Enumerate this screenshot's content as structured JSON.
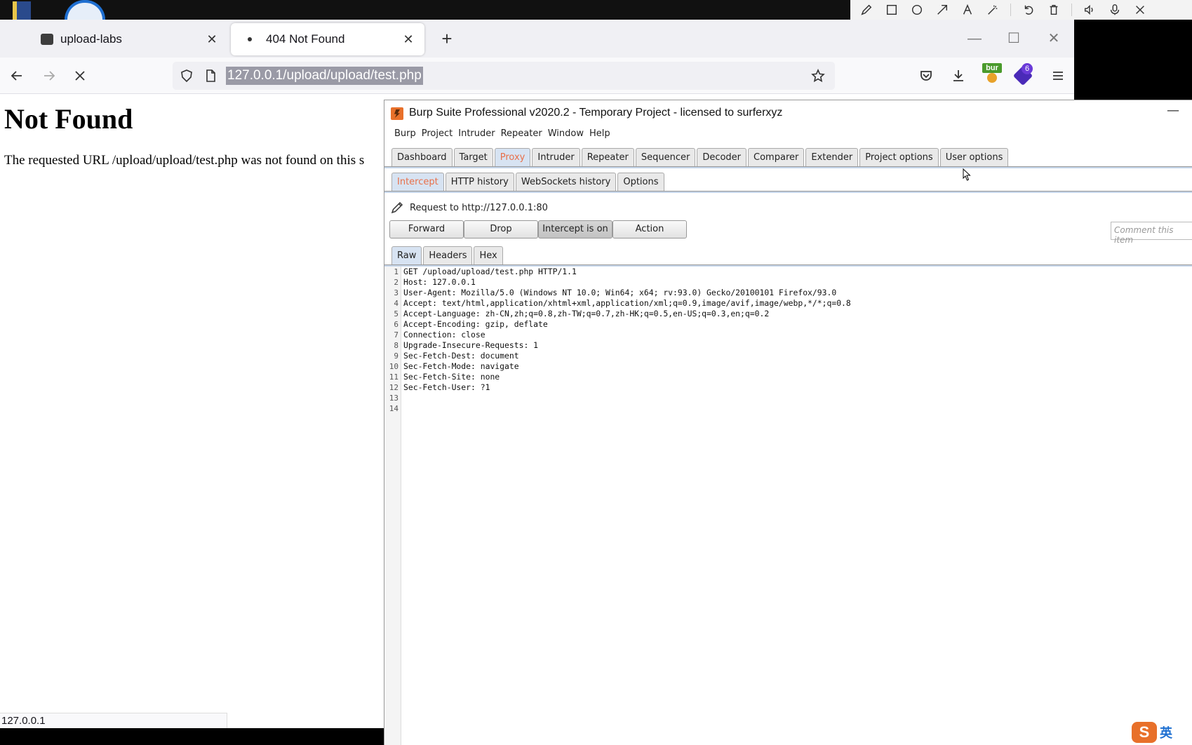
{
  "browser": {
    "tabs": [
      {
        "title": "upload-labs"
      },
      {
        "title": "404 Not Found"
      }
    ],
    "url": "127.0.0.1/upload/upload/test.php",
    "status_url": "127.0.0.1",
    "extensions": {
      "bur_label": "bur",
      "ublock_badge": "6"
    }
  },
  "page": {
    "heading": "Not Found",
    "message": "The requested URL /upload/upload/test.php was not found on this s"
  },
  "burp": {
    "title": "Burp Suite Professional v2020.2 - Temporary Project - licensed to surferxyz",
    "menu": [
      "Burp",
      "Project",
      "Intruder",
      "Repeater",
      "Window",
      "Help"
    ],
    "main_tabs": [
      "Dashboard",
      "Target",
      "Proxy",
      "Intruder",
      "Repeater",
      "Sequencer",
      "Decoder",
      "Comparer",
      "Extender",
      "Project options",
      "User options"
    ],
    "sub_tabs": [
      "Intercept",
      "HTTP history",
      "WebSockets history",
      "Options"
    ],
    "request_to": "Request to http://127.0.0.1:80",
    "buttons": {
      "forward": "Forward",
      "drop": "Drop",
      "intercept": "Intercept is on",
      "action": "Action"
    },
    "comment_placeholder": "Comment this item",
    "view_tabs": [
      "Raw",
      "Headers",
      "Hex"
    ],
    "line_numbers": [
      "1",
      "2",
      "3",
      "4",
      "5",
      "6",
      "7",
      "8",
      "9",
      "10",
      "11",
      "12",
      "13",
      "14"
    ],
    "request_lines": [
      "GET /upload/upload/test.php HTTP/1.1",
      "Host: 127.0.0.1",
      "User-Agent: Mozilla/5.0 (Windows NT 10.0; Win64; x64; rv:93.0) Gecko/20100101 Firefox/93.0",
      "Accept: text/html,application/xhtml+xml,application/xml;q=0.9,image/avif,image/webp,*/*;q=0.8",
      "Accept-Language: zh-CN,zh;q=0.8,zh-TW;q=0.7,zh-HK;q=0.5,en-US;q=0.3,en;q=0.2",
      "Accept-Encoding: gzip, deflate",
      "Connection: close",
      "Upgrade-Insecure-Requests: 1",
      "Sec-Fetch-Dest: document",
      "Sec-Fetch-Mode: navigate",
      "Sec-Fetch-Site: none",
      "Sec-Fetch-User: ?1",
      "",
      ""
    ]
  },
  "ime": {
    "mode": "英"
  },
  "colors": {
    "active_tab_text": "#e8704a",
    "tab_strip": "#c6d6ea",
    "burp_logo": "#e8702a"
  }
}
